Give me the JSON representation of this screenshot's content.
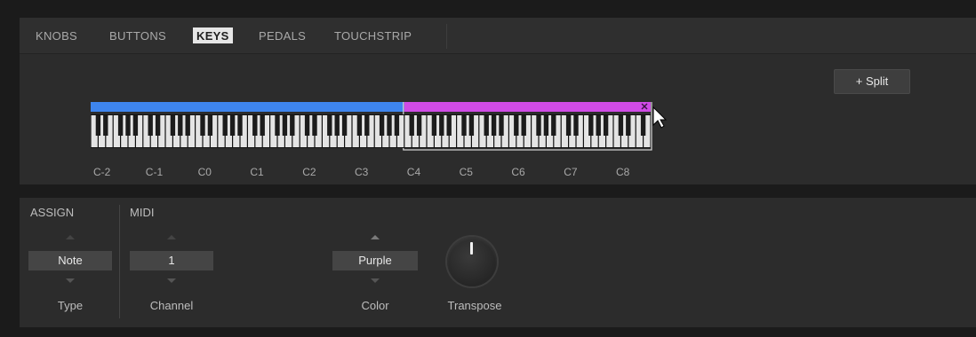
{
  "tabs": [
    {
      "label": "KNOBS",
      "active": false
    },
    {
      "label": "BUTTONS",
      "active": false
    },
    {
      "label": "KEYS",
      "active": true
    },
    {
      "label": "PEDALS",
      "active": false
    },
    {
      "label": "TOUCHSTRIP",
      "active": false
    }
  ],
  "keys": {
    "split_button_label": "+ Split",
    "octave_labels": [
      "C-2",
      "C-1",
      "C0",
      "C1",
      "C2",
      "C3",
      "C4",
      "C5",
      "C6",
      "C7",
      "C8"
    ],
    "zones": [
      {
        "start_octave_label": "C-2",
        "end_note": "B3",
        "color": "#3e85ee",
        "selected": false
      },
      {
        "start_note": "C4",
        "end_octave_label": "C8",
        "color": "#d04be6",
        "selected": true,
        "close_icon": "close-icon"
      }
    ],
    "key_range": {
      "low": "C-2",
      "high": "G8"
    }
  },
  "assign": {
    "title": "ASSIGN",
    "type_value": "Note",
    "type_label": "Type"
  },
  "midi": {
    "title": "MIDI",
    "channel_value": "1",
    "channel_label": "Channel",
    "color_value": "Purple",
    "color_label": "Color",
    "transpose_label": "Transpose"
  }
}
